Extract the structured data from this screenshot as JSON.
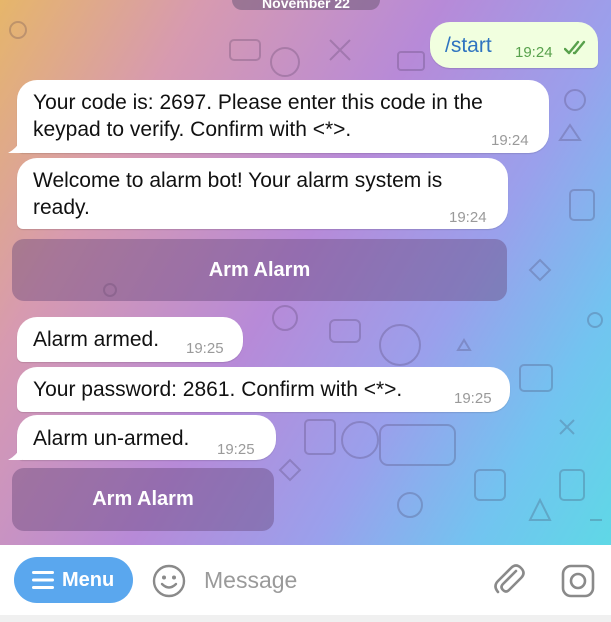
{
  "date_separator": "November 22",
  "messages": [
    {
      "direction": "out",
      "text": "/start",
      "time": "19:24",
      "status": "read"
    },
    {
      "direction": "in",
      "line1": "Your code is: 2697. Please enter this code in the",
      "line2": "keypad to verify. Confirm with <*>.",
      "time": "19:24"
    },
    {
      "direction": "in",
      "line1": "Welcome to alarm bot! Your alarm system is",
      "line2": "ready.",
      "time": "19:24"
    },
    {
      "direction": "in",
      "text": "Alarm armed.",
      "time": "19:25"
    },
    {
      "direction": "in",
      "text": "Your password: 2861. Confirm with <*>.",
      "time": "19:25"
    },
    {
      "direction": "in",
      "text": "Alarm un-armed.",
      "time": "19:25"
    }
  ],
  "inline_buttons": [
    {
      "label": "Arm Alarm"
    },
    {
      "label": "Arm Alarm"
    }
  ],
  "composer": {
    "menu_label": "Menu",
    "placeholder": "Message"
  },
  "icons": {
    "menu": "hamburger-icon",
    "emoji": "smiley-icon",
    "attach": "paperclip-icon",
    "camera": "camera-icon",
    "read_status": "double-check-icon"
  },
  "colors": {
    "menu_button": "#5aa7ee",
    "outgoing_bubble": "#f1ffdf",
    "incoming_bubble": "#ffffff",
    "inline_button": "#64467a",
    "timestamp_out": "#58a14c",
    "link": "#2f74c0"
  }
}
